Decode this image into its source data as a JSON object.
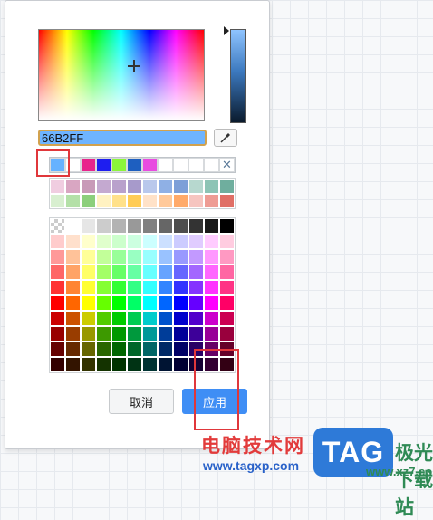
{
  "picker": {
    "hex_value": "66B2FF",
    "eyedropper_icon": "eyedropper-icon",
    "recent_colors": [
      "#66B2FF",
      "#FFFFFF",
      "#E8248C",
      "#1E1EF0",
      "#8BF53A",
      "#1E5FC0",
      "#E84BE0",
      "#FFFFFF",
      "#FFFFFF",
      "#FFFFFF",
      "#FFFFFF"
    ],
    "clear_icon": "close-icon",
    "clear_glyph": "✕",
    "pastel_rows": [
      [
        "#F0CDE0",
        "#D9A6C2",
        "#C89AB8",
        "#C4A9D0",
        "#B9A1CC",
        "#A79ACB",
        "#B9C8EC",
        "#8FB0E5",
        "#7D9FD8",
        "#B7D8CF",
        "#8DC4B5",
        "#6FAE9E"
      ],
      [
        "#D8EFD0",
        "#B4E0A8",
        "#8CCF7C",
        "#FFF2C2",
        "#FFE18A",
        "#FFCC55",
        "#FFE2C8",
        "#FFC99A",
        "#FFAA6A",
        "#F6C5C0",
        "#EE9C94",
        "#E06F66"
      ]
    ],
    "palette_rows": [
      [
        "transparent",
        "#FFFFFF",
        "#E6E6E6",
        "#CCCCCC",
        "#B3B3B3",
        "#999999",
        "#808080",
        "#666666",
        "#4D4D4D",
        "#333333",
        "#1A1A1A",
        "#000000"
      ],
      [
        "#FFCCCC",
        "#FFE0CC",
        "#FFFFCC",
        "#E0FFCC",
        "#CCFFCC",
        "#CCFFE0",
        "#CCFFFF",
        "#CCE0FF",
        "#CCCCFF",
        "#E0CCFF",
        "#FFCCFF",
        "#FFCCE0"
      ],
      [
        "#FF9999",
        "#FFC299",
        "#FFFF99",
        "#C2FF99",
        "#99FF99",
        "#99FFC2",
        "#99FFFF",
        "#99C2FF",
        "#9999FF",
        "#C299FF",
        "#FF99FF",
        "#FF99C2"
      ],
      [
        "#FF6666",
        "#FFA366",
        "#FFFF66",
        "#A3FF66",
        "#66FF66",
        "#66FFA3",
        "#66FFFF",
        "#66A3FF",
        "#6666FF",
        "#A366FF",
        "#FF66FF",
        "#FF66A3"
      ],
      [
        "#FF3333",
        "#FF8533",
        "#FFFF33",
        "#85FF33",
        "#33FF33",
        "#33FF85",
        "#33FFFF",
        "#3385FF",
        "#3333FF",
        "#8533FF",
        "#FF33FF",
        "#FF3385"
      ],
      [
        "#FF0000",
        "#FF6600",
        "#FFFF00",
        "#66FF00",
        "#00FF00",
        "#00FF66",
        "#00FFFF",
        "#0066FF",
        "#0000FF",
        "#6600FF",
        "#FF00FF",
        "#FF0066"
      ],
      [
        "#CC0000",
        "#CC5200",
        "#CCCC00",
        "#52CC00",
        "#00CC00",
        "#00CC52",
        "#00CCCC",
        "#0052CC",
        "#0000CC",
        "#5200CC",
        "#CC00CC",
        "#CC0052"
      ],
      [
        "#990000",
        "#993D00",
        "#999900",
        "#3D9900",
        "#009900",
        "#00993D",
        "#009999",
        "#003D99",
        "#000099",
        "#3D0099",
        "#990099",
        "#99003D"
      ],
      [
        "#660000",
        "#662900",
        "#666600",
        "#296600",
        "#006600",
        "#006629",
        "#006666",
        "#002966",
        "#000066",
        "#290066",
        "#660066",
        "#660029"
      ],
      [
        "#330000",
        "#331400",
        "#333300",
        "#143300",
        "#003300",
        "#003314",
        "#003333",
        "#001433",
        "#000033",
        "#140033",
        "#330033",
        "#330014"
      ]
    ],
    "cancel_label": "取消",
    "apply_label": "应用"
  },
  "watermark": {
    "site_name": "电脑技术网",
    "url": "www.tagxp.com",
    "logo_text": "TAG",
    "side_text": "极光下载站",
    "side_url": "www.xz7.com"
  },
  "colors": {
    "accent": "#3F8EF5",
    "highlight": "#E0373B"
  }
}
